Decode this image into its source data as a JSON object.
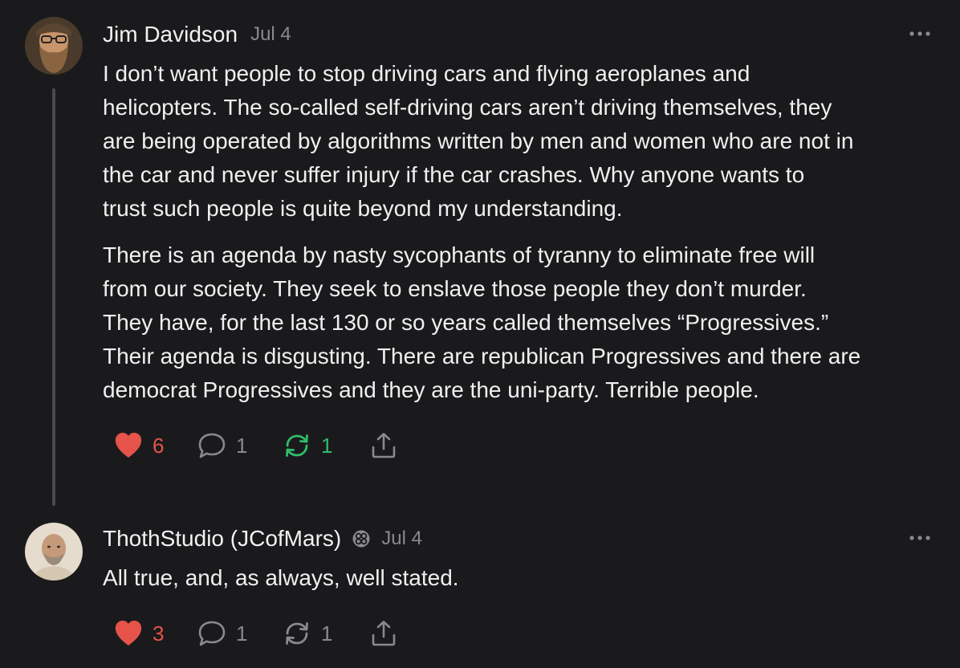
{
  "comments": [
    {
      "author": "Jim Davidson",
      "date": "Jul 4",
      "paragraphs": [
        "I don’t want people to stop driving cars and flying aeroplanes and\nhelicopters. The so-called self-driving cars aren’t driving themselves, they\nare being operated by algorithms written by men and women who are not in\nthe car and never suffer injury if the car crashes. Why anyone wants to\ntrust such people is quite beyond my understanding.",
        "There is an agenda by nasty sycophants of tyranny to eliminate free will\nfrom our society. They seek to enslave those people they don’t murder.\nThey have, for the last 130 or so years called themselves “Progressives.”\nTheir agenda is disgusting. There are republican Progressives and there are\ndemocrat Progressives and they are the uni-party. Terrible people."
      ],
      "likes": "6",
      "replies": "1",
      "restacks": "1",
      "liked": true,
      "restacked": true,
      "icons": {
        "like": "heart-icon",
        "reply": "comment-bubble-icon",
        "restack": "restack-icon",
        "share": "share-icon",
        "more": "more-options-icon"
      }
    },
    {
      "author": "ThothStudio (JCofMars)",
      "date": "Jul 4",
      "badge": "subscriber-badge-icon",
      "paragraphs": [
        "All true, and, as always, well stated."
      ],
      "likes": "3",
      "replies": "1",
      "restacks": "1",
      "liked": true,
      "restacked": false,
      "icons": {
        "like": "heart-icon",
        "reply": "comment-bubble-icon",
        "restack": "restack-icon",
        "share": "share-icon",
        "more": "more-options-icon"
      }
    }
  ],
  "colors": {
    "background": "#1a1a1c",
    "text": "#f0f0f0",
    "muted": "#8a8a8e",
    "like": "#e5534b",
    "restack_active": "#2ebd6b",
    "thread_line": "#4a4a4c"
  }
}
